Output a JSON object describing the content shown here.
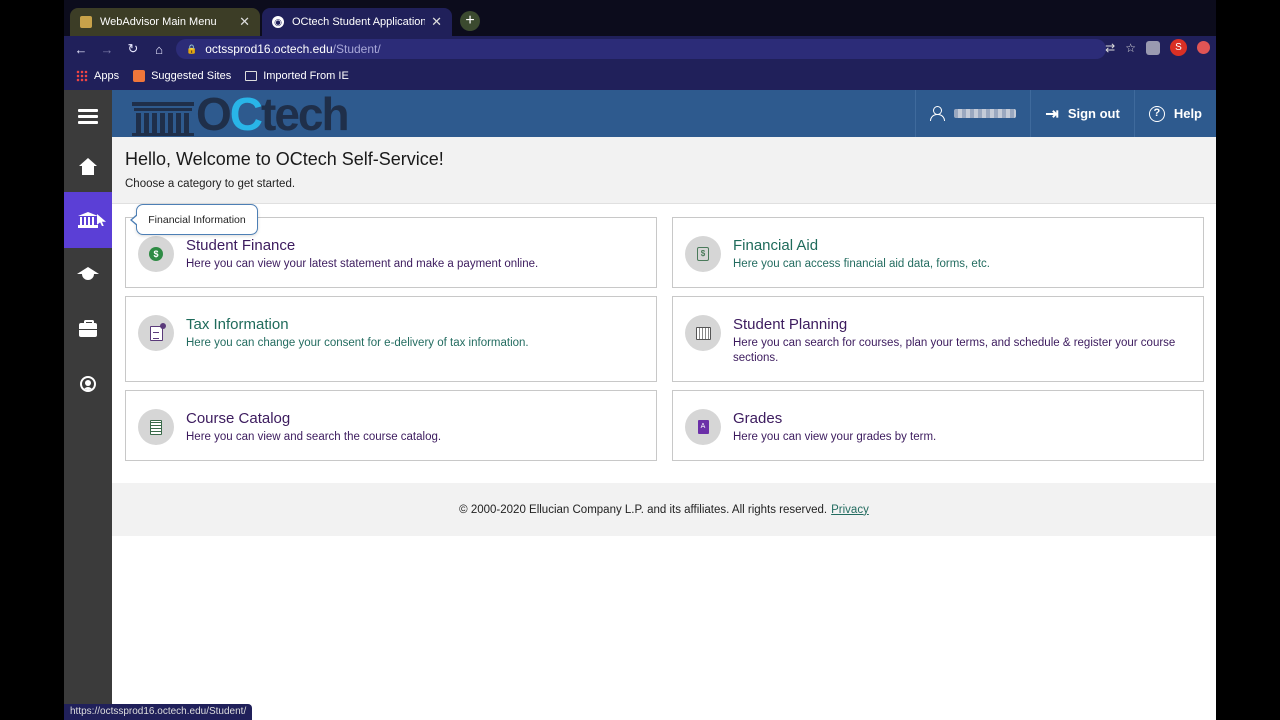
{
  "browser": {
    "tabs": [
      {
        "title": "WebAdvisor Main Menu",
        "active": false
      },
      {
        "title": "OCtech Student Application",
        "active": true
      }
    ],
    "new_tab": "+",
    "url_host": "octssprod16.octech.edu",
    "url_path": "/Student/",
    "profile_initial": "S",
    "bookmarks": [
      {
        "label": "Apps",
        "icon": "apps-icon"
      },
      {
        "label": "Suggested Sites",
        "icon": "suggested-sites-icon"
      },
      {
        "label": "Imported From IE",
        "icon": "folder-icon"
      }
    ],
    "status_url": "https://octssprod16.octech.edu/Student/"
  },
  "header": {
    "logo_text_o": "O",
    "logo_text_c": "C",
    "logo_text_rest": "tech",
    "sign_out": "Sign out",
    "help": "Help"
  },
  "sidenav": {
    "items": [
      "menu-icon",
      "home-icon",
      "bank-icon",
      "graduation-cap-icon",
      "briefcase-icon",
      "person-icon"
    ],
    "tooltip": "Financial Information"
  },
  "welcome": {
    "title": "Hello, Welcome to OCtech Self-Service!",
    "subtitle": "Choose a category to get started."
  },
  "cards": [
    {
      "title": "Student Finance",
      "desc": "Here you can view your latest statement and make a payment online.",
      "icon": "money-icon",
      "color": "#3c1b5e"
    },
    {
      "title": "Financial Aid",
      "desc": "Here you can access financial aid data, forms, etc.",
      "icon": "financial-aid-icon",
      "color": "#1f6b5b"
    },
    {
      "title": "Tax Information",
      "desc": "Here you can change your consent for e-delivery of tax information.",
      "icon": "tax-document-icon",
      "color": "#1f6b5b"
    },
    {
      "title": "Student Planning",
      "desc": "Here you can search for courses, plan your terms, and schedule & register your course sections.",
      "icon": "calendar-plan-icon",
      "color": "#3c1b5e"
    },
    {
      "title": "Course Catalog",
      "desc": "Here you can view and search the course catalog.",
      "icon": "catalog-icon",
      "color": "#3c1b5e"
    },
    {
      "title": "Grades",
      "desc": "Here you can view your grades by term.",
      "icon": "grades-icon",
      "color": "#3c1b5e"
    }
  ],
  "footer": {
    "copyright": "© 2000-2020 Ellucian Company L.P. and its affiliates. All rights reserved.",
    "privacy": "Privacy"
  }
}
